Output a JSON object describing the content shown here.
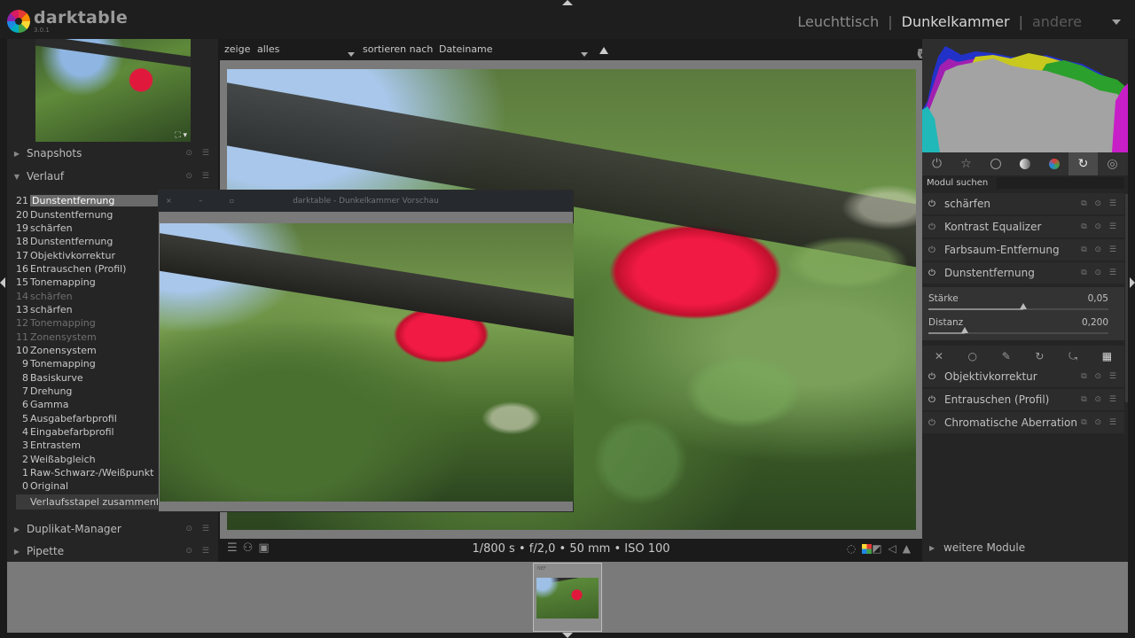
{
  "header": {
    "app_name": "darktable",
    "app_version": "3.0.1",
    "nav": [
      "Leuchttisch",
      "Dunkelkammer",
      "andere"
    ],
    "nav_sep": "|"
  },
  "left_panel": {
    "sections": {
      "snapshots": "Snapshots",
      "history": "Verlauf",
      "duplicate": "Duplikat-Manager",
      "pipette": "Pipette"
    },
    "history": [
      {
        "num": "21",
        "label": "Dunstentfernung",
        "selected": true
      },
      {
        "num": "20",
        "label": "Dunstentfernung"
      },
      {
        "num": "19",
        "label": "schärfen"
      },
      {
        "num": "18",
        "label": "Dunstentfernung"
      },
      {
        "num": "17",
        "label": "Objektivkorrektur"
      },
      {
        "num": "16",
        "label": "Entrauschen (Profil)"
      },
      {
        "num": "15",
        "label": "Tonemapping"
      },
      {
        "num": "14",
        "label": "schärfen",
        "dim": true
      },
      {
        "num": "13",
        "label": "schärfen"
      },
      {
        "num": "12",
        "label": "Tonemapping",
        "dim": true
      },
      {
        "num": "11",
        "label": "Zonensystem",
        "dim": true
      },
      {
        "num": "10",
        "label": "Zonensystem"
      },
      {
        "num": "9",
        "label": "Tonemapping"
      },
      {
        "num": "8",
        "label": "Basiskurve"
      },
      {
        "num": "7",
        "label": "Drehung"
      },
      {
        "num": "6",
        "label": "Gamma"
      },
      {
        "num": "5",
        "label": "Ausgabefarbprofil"
      },
      {
        "num": "4",
        "label": "Eingabefarbprofil"
      },
      {
        "num": "3",
        "label": "Entrastem"
      },
      {
        "num": "2",
        "label": "Weißabgleich"
      },
      {
        "num": "1",
        "label": "Raw-Schwarz-/Weißpunkt"
      },
      {
        "num": "0",
        "label": "Original"
      }
    ],
    "compress_button": "Verlaufsstapel zusammenfassen"
  },
  "center_toolbar": {
    "show_label": "zeige",
    "show_value": "alles",
    "sort_label": "sortieren nach",
    "sort_value": "Dateiname"
  },
  "preview_window": {
    "title": "darktable - Dunkelkammer Vorschau",
    "controls": "× – ▫"
  },
  "bottom_toolbar": {
    "exif": "1/800 s • f/2,0 • 50 mm • ISO 100"
  },
  "right_panel": {
    "module_search_label": "Modul suchen",
    "module_search_value": "",
    "modules_top": [
      {
        "name": "schärfen",
        "on": true
      },
      {
        "name": "Kontrast Equalizer",
        "on": false
      },
      {
        "name": "Farbsaum-Entfernung",
        "on": false
      },
      {
        "name": "Dunstentfernung",
        "on": true
      }
    ],
    "dunst_params": [
      {
        "label": "Stärke",
        "value": "0,05",
        "fraction": 0.525
      },
      {
        "label": "Distanz",
        "value": "0,200",
        "fraction": 0.2
      }
    ],
    "modules_bottom": [
      {
        "name": "Objektivkorrektur",
        "on": true
      },
      {
        "name": "Entrauschen (Profil)",
        "on": true
      },
      {
        "name": "Chromatische Aberration",
        "on": false
      }
    ],
    "more_modules": "weitere Module"
  },
  "filmstrip": {
    "thumb_label": "NEF"
  },
  "colors": {
    "background": "#1b1b1b",
    "panel": "#252525",
    "center_border": "#7a7a7a",
    "selected_row": "#6a6a6a",
    "rose": "#e0183c"
  }
}
